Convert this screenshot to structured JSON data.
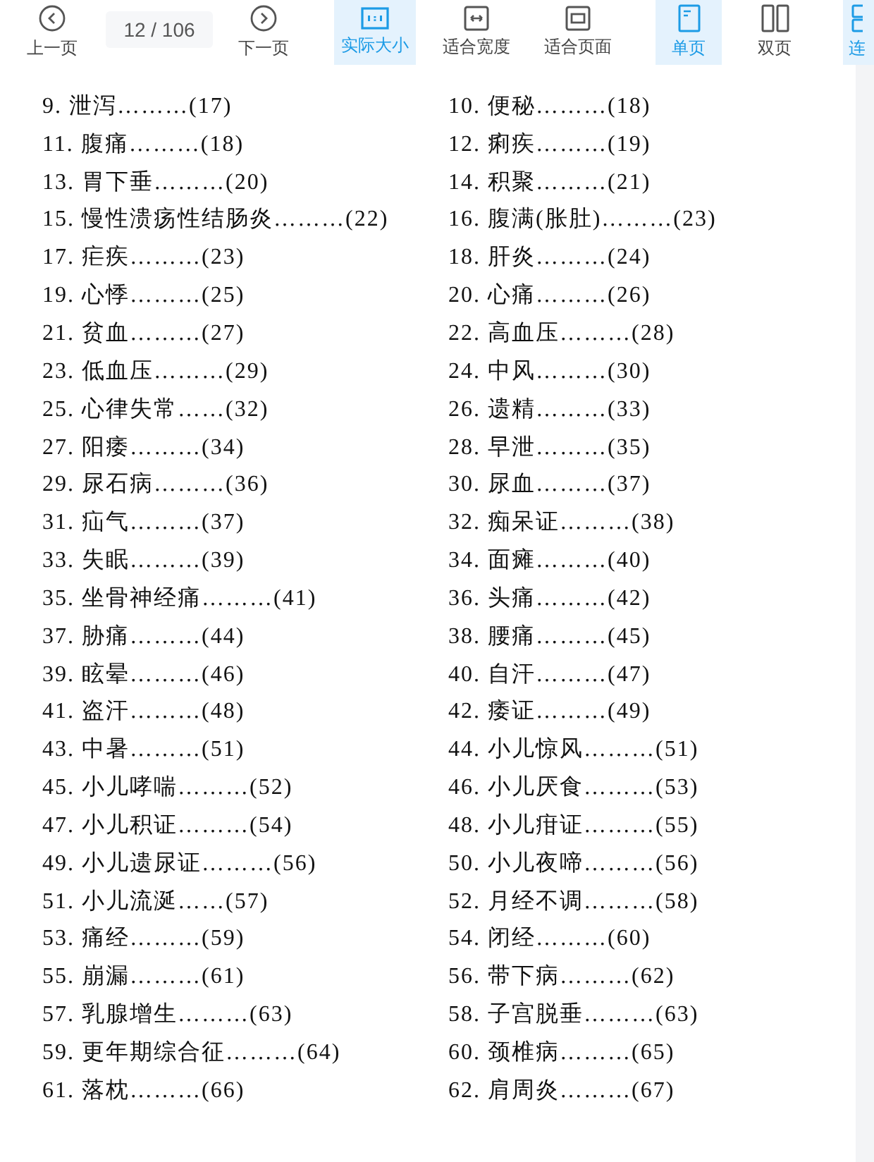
{
  "toolbar": {
    "prev": {
      "label": "上一页"
    },
    "page_field": {
      "value": "12 / 106"
    },
    "next": {
      "label": "下一页"
    },
    "zoom_modes": [
      {
        "kind": "actual",
        "label": "实际大小",
        "selected": true
      },
      {
        "kind": "fit_width",
        "label": "适合宽度",
        "selected": false
      },
      {
        "kind": "fit_page",
        "label": "适合页面",
        "selected": false
      }
    ],
    "page_modes": [
      {
        "kind": "single",
        "label": "单页",
        "selected": true
      },
      {
        "kind": "double",
        "label": "双页",
        "selected": false
      },
      {
        "kind": "continuous",
        "label": "连",
        "selected": true
      }
    ]
  },
  "contents": {
    "rows": [
      [
        "9. 泄泻………(17)",
        "10. 便秘………(18)"
      ],
      [
        "11. 腹痛………(18)",
        "12. 痢疾………(19)"
      ],
      [
        "13. 胃下垂………(20)",
        "14. 积聚………(21)"
      ],
      [
        "15. 慢性溃疡性结肠炎………(22)",
        "16. 腹满(胀肚)………(23)"
      ],
      [
        "17. 疟疾………(23)",
        "18. 肝炎………(24)"
      ],
      [
        "19. 心悸………(25)",
        "20. 心痛………(26)"
      ],
      [
        "21. 贫血………(27)",
        "22. 高血压………(28)"
      ],
      [
        "23. 低血压………(29)",
        "24. 中风………(30)"
      ],
      [
        "25. 心律失常……(32)",
        "26. 遗精………(33)"
      ],
      [
        "27. 阳痿………(34)",
        "28. 早泄………(35)"
      ],
      [
        "29. 尿石病………(36)",
        "30. 尿血………(37)"
      ],
      [
        "31. 疝气………(37)",
        "32. 痴呆证………(38)"
      ],
      [
        "33. 失眠………(39)",
        "34. 面瘫………(40)"
      ],
      [
        "35. 坐骨神经痛………(41)",
        "36. 头痛………(42)"
      ],
      [
        "37. 胁痛………(44)",
        "38. 腰痛………(45)"
      ],
      [
        "39. 眩晕………(46)",
        "40. 自汗………(47)"
      ],
      [
        "41. 盗汗………(48)",
        "42. 痿证………(49)"
      ],
      [
        "43. 中暑………(51)",
        "44. 小儿惊风………(51)"
      ],
      [
        "45. 小儿哮喘………(52)",
        "46. 小儿厌食………(53)"
      ],
      [
        "47. 小儿积证………(54)",
        "48. 小儿疳证………(55)"
      ],
      [
        "49. 小儿遗尿证………(56)",
        "50. 小儿夜啼………(56)"
      ],
      [
        "51. 小儿流涎……(57)",
        "52. 月经不调………(58)"
      ],
      [
        "53. 痛经………(59)",
        "54. 闭经………(60)"
      ],
      [
        "55. 崩漏………(61)",
        "56. 带下病………(62)"
      ],
      [
        "57. 乳腺增生………(63)",
        "58. 子宫脱垂………(63)"
      ],
      [
        "59. 更年期综合征………(64)",
        "60. 颈椎病………(65)"
      ],
      [
        "61. 落枕………(66)",
        "62. 肩周炎………(67)"
      ]
    ]
  }
}
